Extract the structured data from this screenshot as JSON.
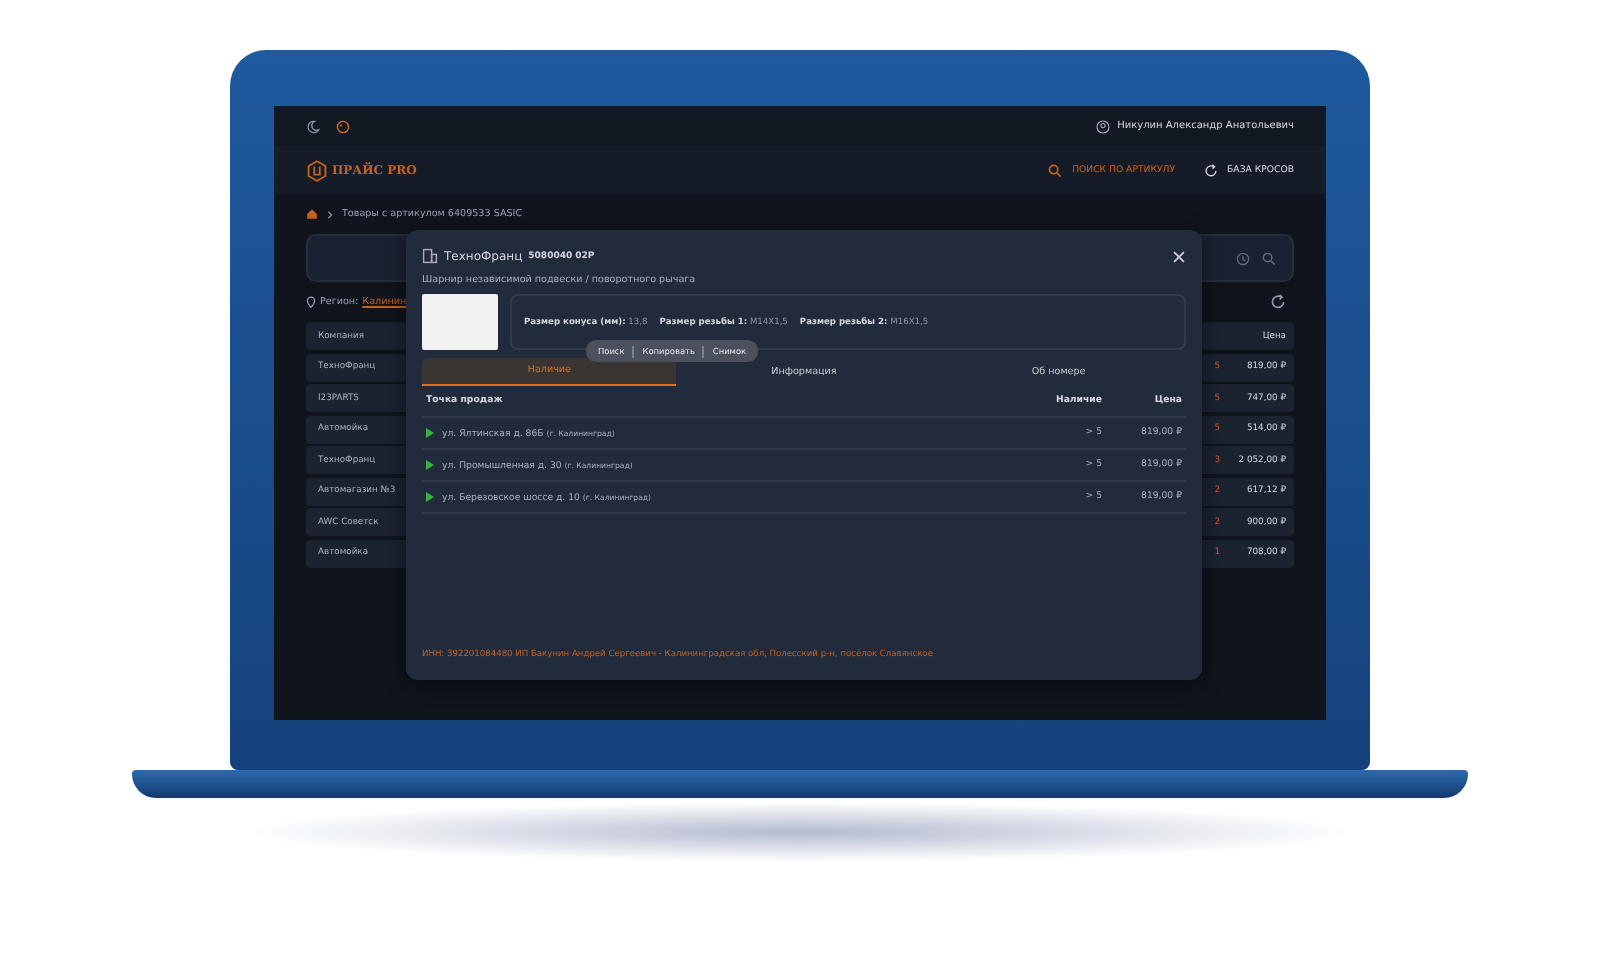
{
  "topbar": {
    "user": "Никулин Александр Анатольевич"
  },
  "header": {
    "logo": "ПРАЙС PRO",
    "nav": [
      {
        "label": "ПОИСК ПО АРТИКУЛУ",
        "selected": true
      },
      {
        "label": "БАЗА КРОСОВ",
        "selected": false
      }
    ]
  },
  "breadcrumb": "Товары с артикулом 6409533 SASIC",
  "region": {
    "label": "Регион:",
    "value": "Калинин"
  },
  "table": {
    "columns": [
      "Компания",
      "Цена"
    ],
    "rows": [
      {
        "company": "ТехноФранц",
        "stock": "5",
        "price": "819,00 ₽"
      },
      {
        "company": "I23PARTS",
        "stock": "5",
        "price": "747,00 ₽"
      },
      {
        "company": "Автомойка",
        "stock": "5",
        "price": "514,00 ₽"
      },
      {
        "company": "ТехноФранц",
        "stock": "3",
        "price": "2 052,00 ₽"
      },
      {
        "company": "Автомагазин №3",
        "stock": "2",
        "price": "617,12 ₽"
      },
      {
        "company": "AWC Советск",
        "stock": "2",
        "price": "900,00 ₽"
      },
      {
        "company": "Автомойка",
        "stock": "1",
        "price": "708,00 ₽"
      }
    ]
  },
  "modal": {
    "title": "ТехноФранц",
    "code": "5080040 02P",
    "description": "Шарнир независимой подвески / поворотного рычага",
    "properties": [
      {
        "label": "Размер конуса (мм):",
        "value": "13,8"
      },
      {
        "label": "Размер резьбы 1:",
        "value": "M14X1,5"
      },
      {
        "label": "Размер резьбы 2:",
        "value": "M16X1,5"
      }
    ],
    "tooltip": [
      "Поиск",
      "Копировать",
      "Снимок"
    ],
    "tabs": [
      {
        "label": "Наличие",
        "selected": true
      },
      {
        "label": "Информация",
        "selected": false
      },
      {
        "label": "Об номере",
        "selected": false
      }
    ],
    "columns": [
      "Точка продаж",
      "Наличие",
      "Цена"
    ],
    "rows": [
      {
        "address": "ул. Ялтинская д. 86Б",
        "city": "(г. Калининград)",
        "stock": "> 5",
        "price": "819,00 ₽"
      },
      {
        "address": "ул. Промышленная д. 30",
        "city": "(г. Калининград)",
        "stock": "> 5",
        "price": "819,00 ₽"
      },
      {
        "address": "ул. Березовское шоссе д. 10",
        "city": "(г. Калининград)",
        "stock": "> 5",
        "price": "819,00 ₽"
      }
    ],
    "footer": "ИНН: 392201084480 ИП Бакунин Андрей Сергеевич - Калининградская обл, Полесский р-н, посёлок Славянское"
  }
}
